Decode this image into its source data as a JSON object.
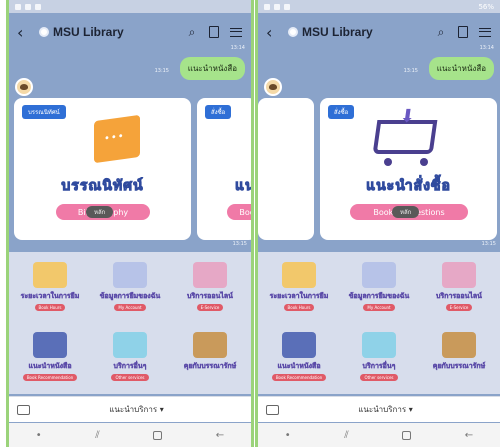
{
  "screens": [
    {
      "status": {
        "right": ""
      },
      "header": {
        "title": "MSU Library"
      },
      "time_top": "13:14",
      "user_message": "แนะนำหนังสือ",
      "user_time": "13:15",
      "cards": [
        {
          "tag": "บรรณนิทัศน์",
          "title": "บรรณนิทัศน์",
          "pill": "Bibliography",
          "play": "หลัก"
        },
        {
          "tag": "สั่งซื้อ",
          "title": "แนะนำ",
          "pill": "Boo",
          "play": ""
        }
      ],
      "card_time": "13:15",
      "rich_menu": [
        {
          "label": "ระยะเวลาในการยืม",
          "sub": "Book Hours"
        },
        {
          "label": "ข้อมูลการยืมของฉัน",
          "sub": "My Account"
        },
        {
          "label": "บริการออนไลน์",
          "sub": "E-Service"
        },
        {
          "label": "แนะนำหนังสือ",
          "sub": "Book Recommendation"
        },
        {
          "label": "บริการอื่นๆ",
          "sub": "Other services"
        },
        {
          "label": "คุยกับบรรณารักษ์",
          "sub": ""
        }
      ],
      "rich_menu_toggle": "แนะนำบริการ ▾"
    },
    {
      "status": {
        "right": "56%"
      },
      "header": {
        "title": "MSU Library"
      },
      "time_top": "13:14",
      "user_message": "แนะนำหนังสือ",
      "user_time": "13:15",
      "cards": [
        {
          "tag": "สั่งซื้อ",
          "title": "แนะนำสั่งซื้อ",
          "pill": "Book Suggestions",
          "play": "หลัก"
        }
      ],
      "card_time": "13:15",
      "rich_menu": [
        {
          "label": "ระยะเวลาในการยืม",
          "sub": "Book Hours"
        },
        {
          "label": "ข้อมูลการยืมของฉัน",
          "sub": "My Account"
        },
        {
          "label": "บริการออนไลน์",
          "sub": "E-Service"
        },
        {
          "label": "แนะนำหนังสือ",
          "sub": "Book Recommendation"
        },
        {
          "label": "บริการอื่นๆ",
          "sub": "Other services"
        },
        {
          "label": "คุยกับบรรณารักษ์",
          "sub": ""
        }
      ],
      "rich_menu_toggle": "แนะนำบริการ ▾"
    }
  ],
  "colors": {
    "chat_bg": "#8aa3c9",
    "user_bubble": "#a6e38b",
    "tag_blue": "#2f6fd6",
    "pill_pink": "#f07aa7",
    "frame_green": "#9bd37a"
  },
  "icons": {
    "nav": [
      "back-icon",
      "search-icon",
      "document-icon",
      "menu-icon"
    ],
    "system_nav": [
      "dot-icon",
      "recent-icon",
      "home-icon",
      "back-arrow-icon"
    ]
  }
}
